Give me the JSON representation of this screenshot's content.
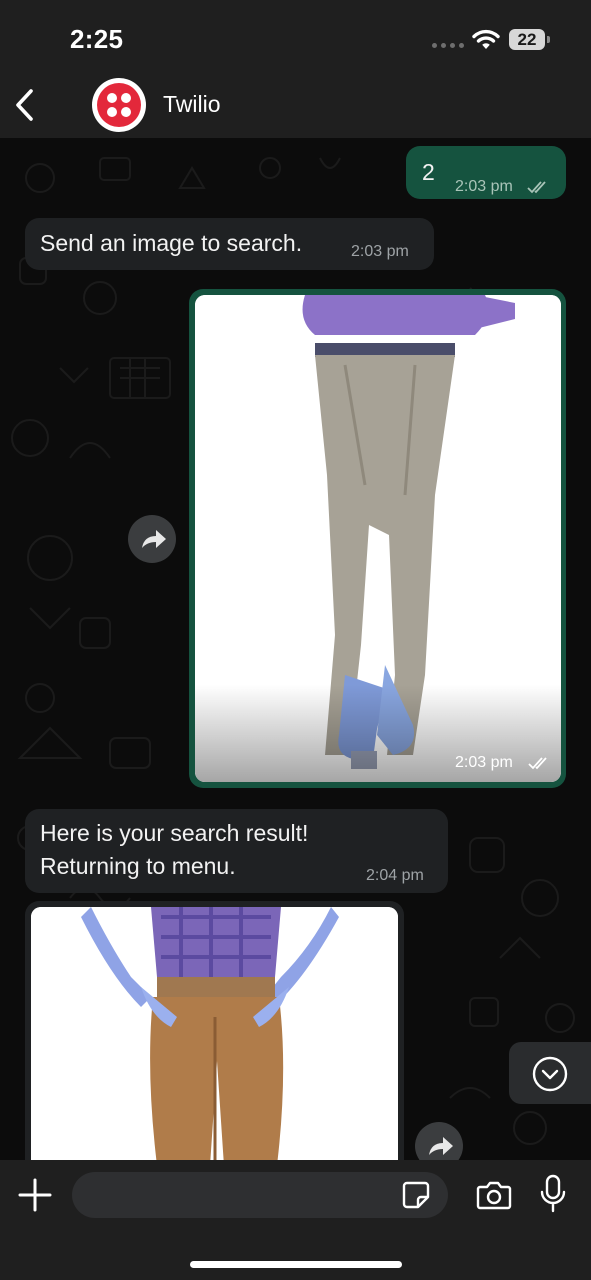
{
  "status_bar": {
    "time": "2:25",
    "battery": "22",
    "icons": [
      "signal-dots",
      "wifi-icon",
      "battery-icon"
    ]
  },
  "header": {
    "contact_name": "Twilio",
    "back_icon": "chevron-left-icon",
    "avatar_icon": "twilio-logo"
  },
  "messages": [
    {
      "direction": "outgoing",
      "type": "text",
      "text": "2",
      "time": "2:03 pm",
      "status": "read"
    },
    {
      "direction": "incoming",
      "type": "text",
      "text": "Send an image to search.",
      "time": "2:03 pm"
    },
    {
      "direction": "outgoing",
      "type": "image",
      "time": "2:03 pm",
      "status": "read"
    },
    {
      "direction": "incoming",
      "type": "text",
      "text": "Here is your search result!\nReturning to menu.",
      "time": "2:04 pm"
    },
    {
      "direction": "incoming",
      "type": "image"
    }
  ],
  "input_bar": {
    "placeholder": "",
    "icons": [
      "plus-icon",
      "sticker-icon",
      "camera-icon",
      "microphone-icon"
    ]
  },
  "colors": {
    "outgoing_bubble": "#15533f",
    "incoming_bubble": "#1f2123",
    "bar_background": "#1f1f1f",
    "twilio_red": "#e3283b"
  }
}
